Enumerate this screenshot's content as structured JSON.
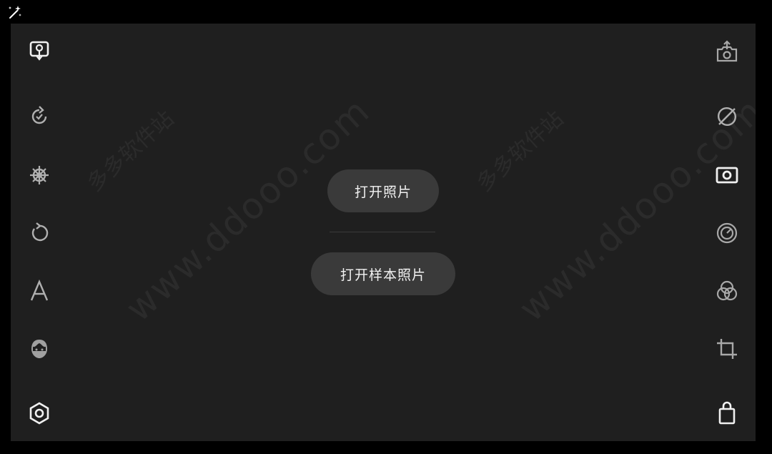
{
  "app": {
    "corner_icon": "magic-wand-icon"
  },
  "watermarks": {
    "brand_cn": "多多软件站",
    "site": "www.ddooo.com"
  },
  "left_toolbar": [
    {
      "icon": "monitor-download-icon"
    },
    {
      "icon": "refresh-arrow-icon"
    },
    {
      "icon": "ship-wheel-icon"
    },
    {
      "icon": "undo-rotate-icon"
    },
    {
      "icon": "text-a-icon"
    },
    {
      "icon": "face-icon"
    },
    {
      "icon": "hexagon-settings-icon"
    }
  ],
  "right_toolbar": [
    {
      "icon": "camera-share-icon"
    },
    {
      "icon": "healing-icon"
    },
    {
      "icon": "vignette-icon"
    },
    {
      "icon": "dial-icon"
    },
    {
      "icon": "color-circles-icon"
    },
    {
      "icon": "crop-icon"
    },
    {
      "icon": "shopping-bag-icon"
    }
  ],
  "main": {
    "open_photo_label": "打开照片",
    "open_sample_label": "打开样本照片"
  },
  "colors": {
    "background": "#1f1f1f",
    "button": "#3a3a3a",
    "icon": "#e8e8e8",
    "icon_dim": "#a8a8a8"
  }
}
